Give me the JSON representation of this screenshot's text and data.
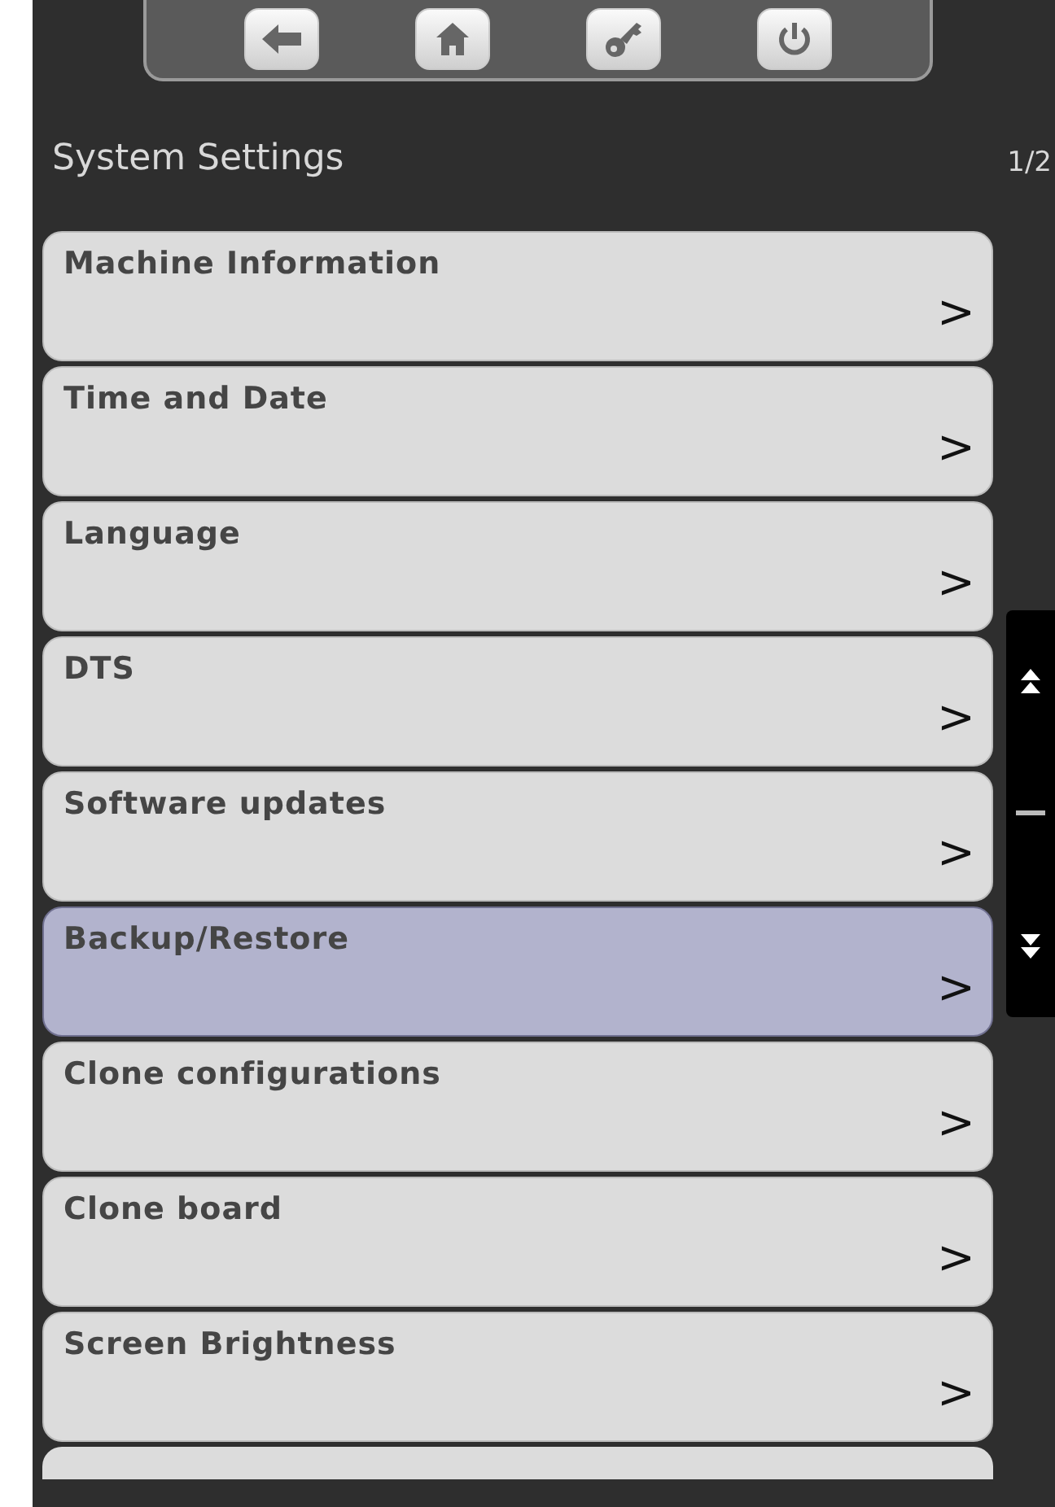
{
  "toolbar": {
    "buttons": [
      {
        "kind": "back"
      },
      {
        "kind": "home"
      },
      {
        "kind": "key"
      },
      {
        "kind": "power"
      }
    ]
  },
  "header": {
    "title": "System Settings",
    "page": "1/2"
  },
  "menu": [
    {
      "label": "Machine Information",
      "arrow": ">",
      "selected": false
    },
    {
      "label": "Time and Date",
      "arrow": ">",
      "selected": false
    },
    {
      "label": "Language",
      "arrow": ">",
      "selected": false
    },
    {
      "label": "DTS",
      "arrow": ">",
      "selected": false
    },
    {
      "label": "Software updates",
      "arrow": ">",
      "selected": false
    },
    {
      "label": "Backup/Restore",
      "arrow": ">",
      "selected": true
    },
    {
      "label": "Clone configurations",
      "arrow": ">",
      "selected": false
    },
    {
      "label": "Clone board",
      "arrow": ">",
      "selected": false
    },
    {
      "label": "Screen Brightness",
      "arrow": ">",
      "selected": false
    }
  ]
}
